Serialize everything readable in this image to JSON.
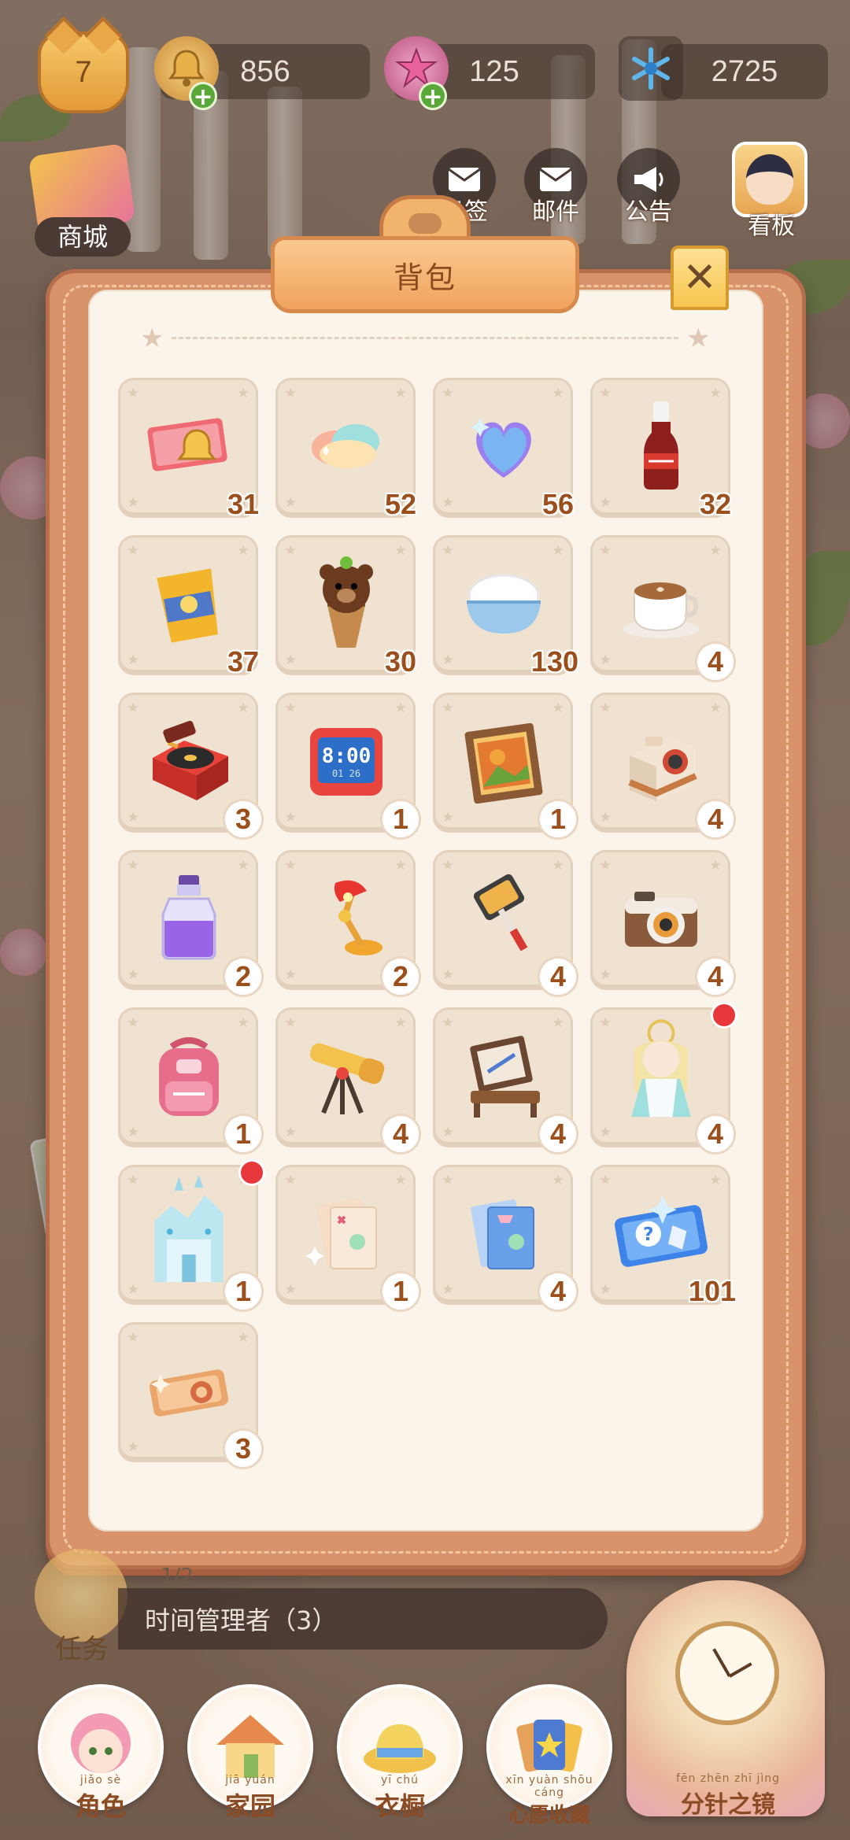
{
  "header": {
    "level": "7",
    "currencies": [
      {
        "name": "bell",
        "value": "856",
        "icon": "bell-icon",
        "has_plus": true
      },
      {
        "name": "gem",
        "value": "125",
        "icon": "star-gem-icon",
        "has_plus": true
      },
      {
        "name": "snowflake",
        "value": "2725",
        "icon": "snowflake-icon",
        "has_plus": false
      }
    ]
  },
  "top_buttons": {
    "shop": "商城",
    "checkin": "日签",
    "mail": "邮件",
    "notice": "公告",
    "board": "看板"
  },
  "bag": {
    "title": "背包",
    "close_label": "✕",
    "items": [
      {
        "icon": "ticket-bell-icon",
        "count": "31"
      },
      {
        "icon": "cloud-candy-icon",
        "count": "52"
      },
      {
        "icon": "heart-balloon-icon",
        "count": "56"
      },
      {
        "icon": "cola-bottle-icon",
        "count": "32"
      },
      {
        "icon": "chips-bag-icon",
        "count": "37"
      },
      {
        "icon": "bear-icecream-icon",
        "count": "30"
      },
      {
        "icon": "rice-bowl-icon",
        "count": "130"
      },
      {
        "icon": "coffee-cup-icon",
        "count": "4"
      },
      {
        "icon": "record-player-icon",
        "count": "3"
      },
      {
        "icon": "digital-clock-icon",
        "count": "1",
        "clock_time": "8:00",
        "clock_date": "01 26"
      },
      {
        "icon": "painting-frame-icon",
        "count": "1"
      },
      {
        "icon": "instant-camera-icon",
        "count": "4"
      },
      {
        "icon": "potion-bottle-icon",
        "count": "2"
      },
      {
        "icon": "desk-lamp-icon",
        "count": "2"
      },
      {
        "icon": "selfie-stick-icon",
        "count": "4"
      },
      {
        "icon": "retro-camera-icon",
        "count": "4"
      },
      {
        "icon": "backpack-icon",
        "count": "1"
      },
      {
        "icon": "telescope-icon",
        "count": "4"
      },
      {
        "icon": "easel-icon",
        "count": "4"
      },
      {
        "icon": "character-figure-icon",
        "count": "4",
        "red_dot": true
      },
      {
        "icon": "ice-castle-icon",
        "count": "1",
        "red_dot": true
      },
      {
        "icon": "photo-cards-icon",
        "count": "1"
      },
      {
        "icon": "blue-photo-cards-icon",
        "count": "4"
      },
      {
        "icon": "mystery-ticket-icon",
        "count": "101",
        "ticket_mark": "?"
      },
      {
        "icon": "gold-ticket-icon",
        "count": "3"
      }
    ]
  },
  "task": {
    "progress": "1/2",
    "name": "时间管理者（3）",
    "label": "任务"
  },
  "bottom_nav": [
    {
      "label": "角色",
      "pinyin": "jiǎo sè",
      "icon": "character-icon"
    },
    {
      "label": "家园",
      "pinyin": "jiā yuán",
      "icon": "house-icon"
    },
    {
      "label": "衣橱",
      "pinyin": "yī chú",
      "icon": "hat-icon"
    },
    {
      "label": "心愿收藏",
      "pinyin": "xīn yuàn shōu cáng",
      "icon": "cards-icon"
    },
    {
      "label": "分针之镜",
      "pinyin": "fēn zhēn zhī jìng",
      "icon": "clock-icon"
    }
  ],
  "colors": {
    "panel": "#d9936a",
    "inner": "#fbf4ea",
    "slot": "#efe2d0",
    "count_text": "#9b4f1c",
    "red_dot": "#e8373b"
  }
}
